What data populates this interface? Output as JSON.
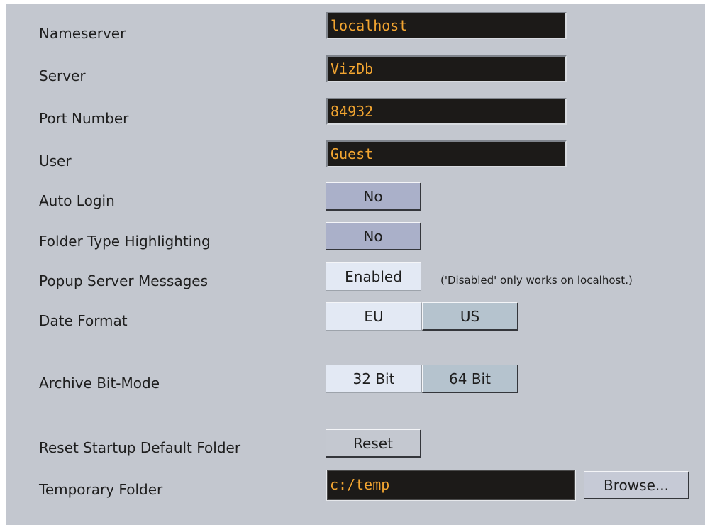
{
  "settings": {
    "nameserver": {
      "label": "Nameserver",
      "value": "localhost"
    },
    "server": {
      "label": "Server",
      "value": "VizDb"
    },
    "port": {
      "label": "Port Number",
      "value": "84932"
    },
    "user": {
      "label": "User",
      "value": "Guest"
    },
    "auto_login": {
      "label": "Auto Login",
      "value": "No"
    },
    "folder_type_highlighting": {
      "label": "Folder Type Highlighting",
      "value": "No"
    },
    "popup_server_messages": {
      "label": "Popup Server Messages",
      "value": "Enabled",
      "note": "('Disabled' only works on localhost.)"
    },
    "date_format": {
      "label": "Date Format",
      "options": [
        "EU",
        "US"
      ],
      "selected": "EU"
    },
    "archive_bit_mode": {
      "label": "Archive Bit-Mode",
      "options": [
        "32 Bit",
        "64 Bit"
      ],
      "selected": "32 Bit"
    },
    "reset_startup_folder": {
      "label": "Reset Startup Default Folder",
      "button": "Reset"
    },
    "temporary_folder": {
      "label": "Temporary Folder",
      "value": "c:/temp",
      "button": "Browse..."
    }
  },
  "colors": {
    "panel_bg": "#c3c7cf",
    "field_bg": "#1c1a18",
    "field_text": "#f2a531",
    "toggle_no_bg": "#aab0c9",
    "selected_bg": "#e3e9f4",
    "unselected_bg": "#b5c3ce"
  }
}
